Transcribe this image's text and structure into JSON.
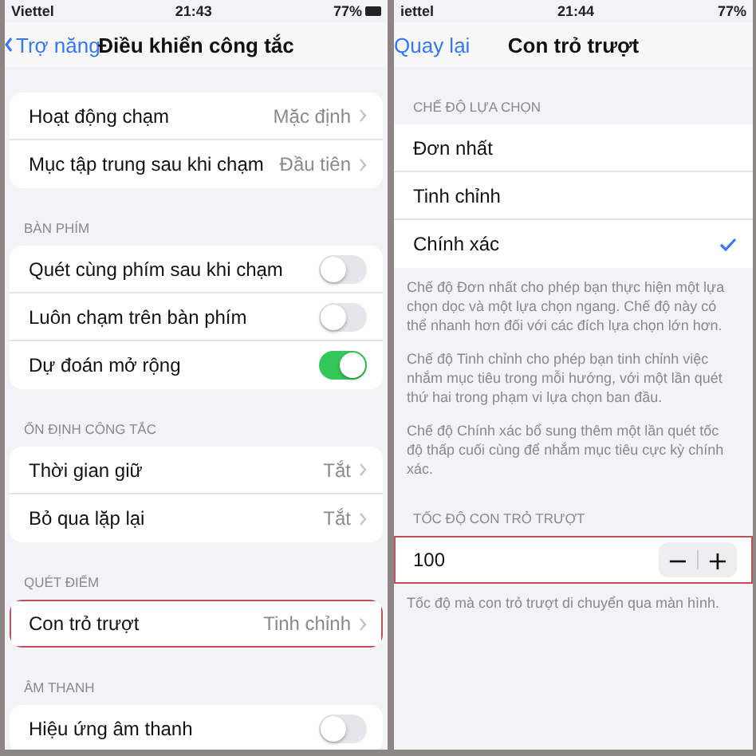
{
  "screens": [
    {
      "status": {
        "carrier": "Viettel",
        "time": "21:43",
        "battery": "77%"
      },
      "nav": {
        "back": "Trợ năng",
        "title": "Điều khiển công tắc"
      },
      "sections": [
        {
          "rows": [
            {
              "kind": "link",
              "label": "Hoạt động chạm",
              "value": "Mặc định",
              "highlighted": false
            },
            {
              "kind": "link",
              "label": "Mục tập trung sau khi chạm",
              "value": "Đầu tiên",
              "highlighted": false
            }
          ]
        },
        {
          "header": "BÀN PHÍM",
          "rows": [
            {
              "kind": "toggle",
              "label": "Quét cùng phím sau khi chạm",
              "on": false,
              "highlighted": false
            },
            {
              "kind": "toggle",
              "label": "Luôn chạm trên bàn phím",
              "on": false,
              "highlighted": false
            },
            {
              "kind": "toggle",
              "label": "Dự đoán mở rộng",
              "on": true,
              "highlighted": false
            }
          ]
        },
        {
          "header": "ỔN ĐỊNH CÔNG TẮC",
          "rows": [
            {
              "kind": "link",
              "label": "Thời gian giữ",
              "value": "Tắt",
              "highlighted": false
            },
            {
              "kind": "link",
              "label": "Bỏ qua lặp lại",
              "value": "Tắt",
              "highlighted": false
            }
          ]
        },
        {
          "header": "QUÉT ĐIỂM",
          "rows": [
            {
              "kind": "link",
              "label": "Con trỏ trượt",
              "value": "Tinh chỉnh",
              "highlighted": true
            }
          ]
        },
        {
          "header": "ÂM THANH",
          "rows": [
            {
              "kind": "toggle",
              "label": "Hiệu ứng âm thanh",
              "on": false,
              "highlighted": false
            }
          ]
        }
      ]
    },
    {
      "status": {
        "carrier": "iettel",
        "time": "21:44",
        "battery": "77%"
      },
      "nav": {
        "back": "Quay lại",
        "title": "Con trỏ trượt"
      },
      "sections": [
        {
          "header": "CHẾ ĐỘ LỰA CHỌN",
          "rows": [
            {
              "kind": "check",
              "label": "Đơn nhất",
              "selected": false,
              "highlighted": false
            },
            {
              "kind": "check",
              "label": "Tinh chỉnh",
              "selected": false,
              "highlighted": false
            },
            {
              "kind": "check",
              "label": "Chính xác",
              "selected": true,
              "highlighted": false
            }
          ],
          "footers": [
            "Chế độ Đơn nhất cho phép bạn thực hiện một lựa chọn dọc và một lựa chọn ngang. Chế độ này có thể nhanh hơn đối với các đích lựa chọn lớn hơn.",
            "Chế độ Tinh chỉnh cho phép bạn tinh chỉnh việc nhắm mục tiêu trong mỗi hướng, với một lần quét thứ hai trong phạm vi lựa chọn ban đầu.",
            "Chế độ Chính xác bổ sung thêm một lần quét tốc độ thấp cuối cùng để nhắm mục tiêu cực kỳ chính xác."
          ]
        },
        {
          "header": "TỐC ĐỘ CON TRỎ TRƯỢT",
          "rows": [
            {
              "kind": "stepper",
              "value": "100",
              "minus": "−",
              "plus": "+",
              "highlighted": true
            }
          ],
          "footers": [
            "Tốc độ mà con trỏ trượt di chuyển qua màn hình."
          ]
        }
      ]
    }
  ]
}
